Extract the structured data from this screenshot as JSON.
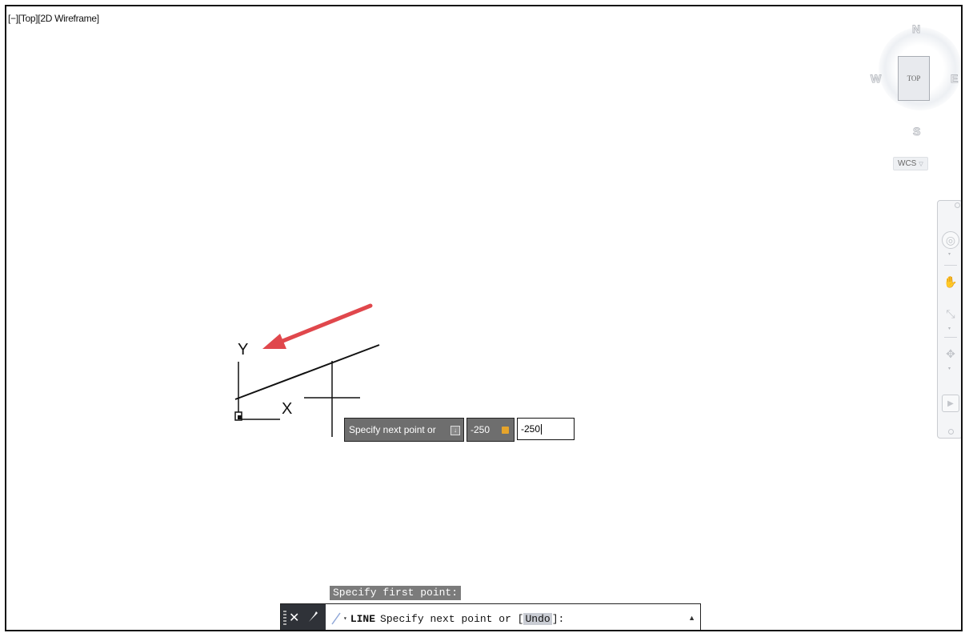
{
  "viewport": {
    "label": "[−][Top][2D Wireframe]"
  },
  "viewcube": {
    "north": "N",
    "south": "S",
    "east": "E",
    "west": "W",
    "face": "TOP",
    "wcs": "WCS",
    "wcs_arrow": "▽"
  },
  "navbar": {
    "icons": [
      "steering-wheel-icon",
      "pan-icon",
      "zoom-icon",
      "orbit-icon",
      "showmotion-icon"
    ]
  },
  "ucs": {
    "x_label": "X",
    "y_label": "Y"
  },
  "dynamic_input": {
    "prompt": "Specify next point or",
    "prompt_icon": "↓",
    "value1": "-250",
    "value2": "-250"
  },
  "command": {
    "history": "Specify first point:",
    "name": "LINE",
    "prompt": "Specify next point or [",
    "option": "Undo",
    "suffix": "]:",
    "dropdown": "▾",
    "scroll": "▲",
    "close": "✕",
    "wrench": "⚒"
  },
  "colors": {
    "arrow": "#e0474c",
    "tooltip": "#6e6e6e",
    "command_tools": "#2f3238"
  }
}
